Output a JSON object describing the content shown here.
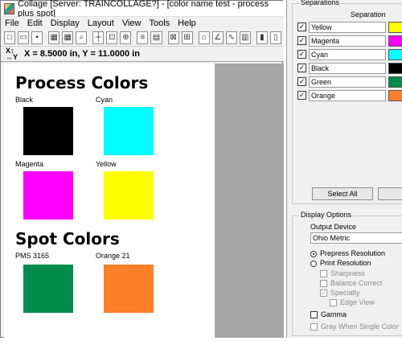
{
  "window": {
    "title": "Collage [Server: TRAINCOLLAGE?] - [color name test - process plus spot]"
  },
  "menu": [
    "File",
    "Edit",
    "Display",
    "Layout",
    "View",
    "Tools",
    "Help"
  ],
  "coordinates": {
    "text": "X = 8.5000 in, Y = 11.0000 in"
  },
  "document": {
    "process_heading": "Process Colors",
    "spot_heading": "Spot Colors",
    "swatches": [
      {
        "label": "Black",
        "color": "#000000"
      },
      {
        "label": "Cyan",
        "color": "#00ffff"
      },
      {
        "label": "Magenta",
        "color": "#ff00ff"
      },
      {
        "label": "Yellow",
        "color": "#ffff00"
      },
      {
        "label": "PMS 3165",
        "color": "#008c4a"
      },
      {
        "label": "Orange 21",
        "color": "#ff7f27"
      }
    ]
  },
  "separations": {
    "title": "Separations",
    "column_header": "Separation",
    "rows": [
      {
        "name": "Yellow",
        "checked": true,
        "color": "#ffff00"
      },
      {
        "name": "Magenta",
        "checked": true,
        "color": "#ff00ff"
      },
      {
        "name": "Cyan",
        "checked": true,
        "color": "#00ffff"
      },
      {
        "name": "Black",
        "checked": true,
        "color": "#000000"
      },
      {
        "name": "Green",
        "checked": true,
        "color": "#008c4a"
      },
      {
        "name": "Orange",
        "checked": true,
        "color": "#ff7f27"
      }
    ],
    "select_all_label": "Select All"
  },
  "display_options": {
    "title": "Display Options",
    "output_device_label": "Output Device",
    "output_device_value": "Ohio Metric",
    "prepress_resolution": "Prepress Resolution",
    "print_resolution": "Print Resolution",
    "sharpness": "Sharpness",
    "balance_correct": "Balance Correct",
    "specialty": "Specialty",
    "edge_view": "Edge View",
    "gamma": "Gamma",
    "gray_when_single": "Gray When Single Color"
  }
}
